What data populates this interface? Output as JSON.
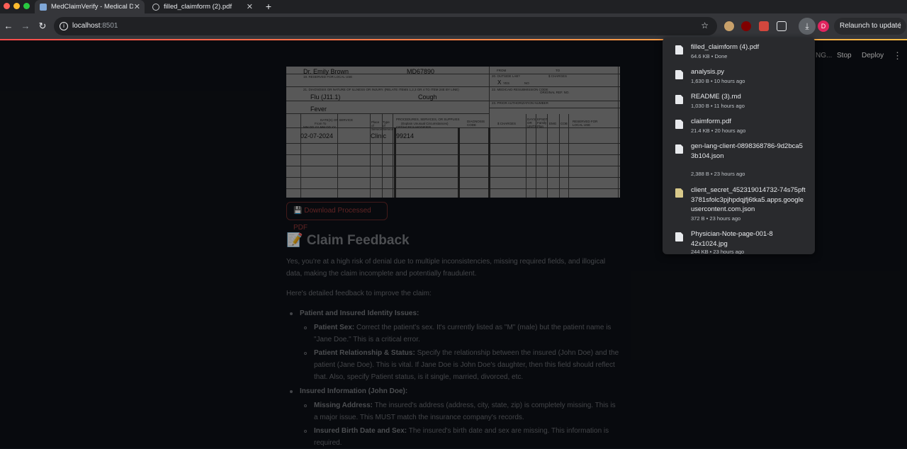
{
  "browser": {
    "tabs": [
      {
        "title": "MedClaimVerify - Medical Do",
        "active": true
      },
      {
        "title": "filled_claimform (2).pdf",
        "active": false
      }
    ],
    "url_host": "localhost",
    "url_port": ":8501",
    "relaunch_label": "Relaunch to update",
    "profile_initial": "D"
  },
  "app_header": {
    "running_label": "NG...",
    "stop_label": "Stop",
    "deploy_label": "Deploy"
  },
  "claim_form": {
    "physician": "Dr. Emily Brown",
    "npi": "MD67890",
    "diag1": "Flu (J11.1)",
    "diag2": "Cough",
    "diag3": "Fever",
    "date": "02-07-2024",
    "place": "Clinic",
    "cpt": "99214",
    "yes_mark": "X",
    "tiny": {
      "reserved": "19. RESERVED FOR LOCAL USE",
      "diagnosis": "21. DIAGNOSIS OR NATURE OF ILLNESS OR INJURY. (RELATE ITEMS 1,2,3 OR 4 TO ITEM 24E BY LINE)",
      "outside_lab": "20. OUTSIDE LAB?",
      "charges": "$ CHARGES",
      "yes": "YES",
      "no": "NO",
      "resubmission": "22. MEDICAID RESUBMISSION CODE",
      "original_ref": "ORIGINAL REF. NO.",
      "prior_auth": "23. PRIOR AUTHORIZATION NUMBER",
      "dates_of_service": "DATE(S) OF SERVICE",
      "from_to": "From          To",
      "mm_dd_yy": "MM  DD  YY  MM  DD  YY",
      "place_of_service": "Place of Service",
      "type_of_service": "Type of Service",
      "procedures": "PROCEDURES, SERVICES, OR SUPPLIES",
      "explain": "(Explain Unusual Circumstances)",
      "cpt_hcpcs": "CPT/HCPCS    MODIFIER",
      "diagnosis_code": "DIAGNOSIS CODE",
      "days_or_units": "DAYS OR UNITS",
      "epsdt": "EPSDT Family Plan",
      "emg": "EMG",
      "cob": "COB",
      "reserved_local": "RESERVED FOR LOCAL USE",
      "from": "FROM",
      "to": "TO"
    }
  },
  "download_button_label": "💾 Download Processed PDF",
  "feedback": {
    "title": "📝 Claim Feedback",
    "intro": "Yes, you're at a high risk of denial due to multiple inconsistencies, missing required fields, and illogical data, making the claim incomplete and potentially fraudulent.",
    "subintro": "Here's detailed feedback to improve the claim:",
    "sections": [
      {
        "heading": "Patient and Insured Identity Issues:",
        "items": [
          {
            "label": "Patient Sex:",
            "text": " Correct the patient's sex. It's currently listed as \"M\" (male) but the patient name is \"Jane Doe.\" This is a critical error."
          },
          {
            "label": "Patient Relationship & Status:",
            "text": " Specify the relationship between the insured (John Doe) and the patient (Jane Doe). This is vital. If Jane Doe is John Doe's daughter, then this field should reflect that. Also, specify Patient status, is it single, married, divorced, etc."
          }
        ]
      },
      {
        "heading": "Insured Information (John Doe):",
        "items": [
          {
            "label": "Missing Address:",
            "text": " The insured's address (address, city, state, zip) is completely missing. This is a major issue. This MUST match the insurance company's records."
          },
          {
            "label": "Insured Birth Date and Sex:",
            "text": " The insured's birth date and sex are missing. This information is required."
          }
        ]
      }
    ]
  },
  "downloads": [
    {
      "name": "filled_claimform (4).pdf",
      "meta": "64.6 KB • Done"
    },
    {
      "name": "analysis.py",
      "meta": "1,630 B • 10 hours ago"
    },
    {
      "name": "README (3).md",
      "meta": "1,030 B • 11 hours ago"
    },
    {
      "name": "claimform.pdf",
      "meta": "21.4 KB • 20 hours ago"
    },
    {
      "name": "gen-lang-client-0898368786-9d2bca53b104.json",
      "meta": "2,388 B • 23 hours ago"
    },
    {
      "name": "client_secret_452319014732-74s75pft3781sfolc3pjhpdqjfj6tka5.apps.googleusercontent.com.json",
      "meta": "372 B • 23 hours ago"
    },
    {
      "name": "Physician-Note-page-001-842x1024.jpg",
      "meta": "244 KB • 23 hours ago"
    }
  ],
  "colors": {
    "accent_red": "#ff4b4b",
    "background": "#0e1117",
    "panel": "#292a2d"
  }
}
